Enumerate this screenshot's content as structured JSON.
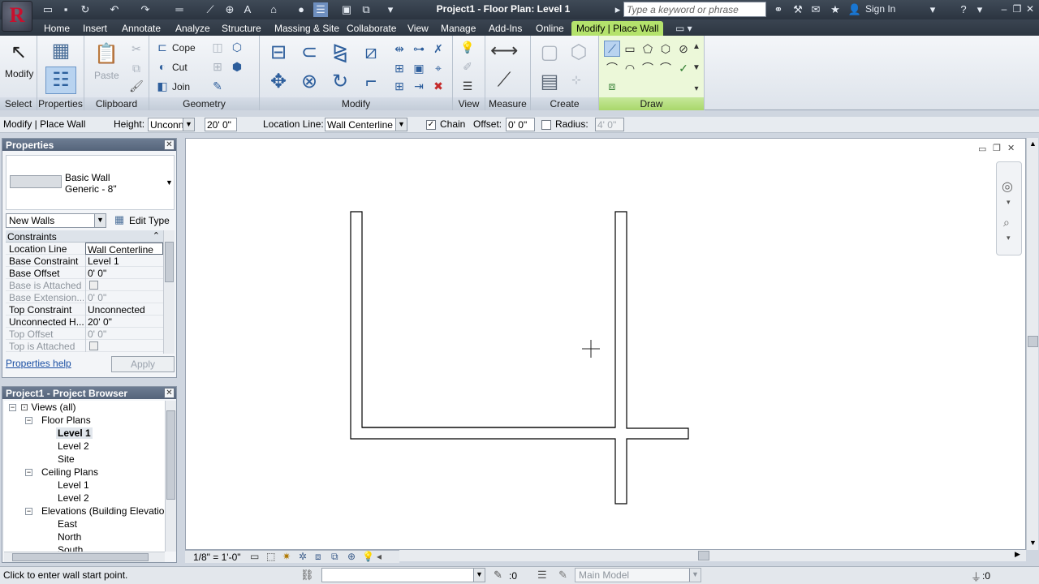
{
  "app": {
    "logo_letter": "R",
    "window_title": "Project1 - Floor Plan: Level 1",
    "search_placeholder": "Type a keyword or phrase",
    "sign_in": "Sign In"
  },
  "ribbon": {
    "tabs": [
      "Home",
      "Insert",
      "Annotate",
      "Analyze",
      "Structure",
      "Massing & Site",
      "Collaborate",
      "View",
      "Manage",
      "Add-Ins",
      "Online",
      "Modify | Place Wall"
    ],
    "active_tab": "Modify | Place Wall",
    "panels": {
      "select": "Select",
      "properties": "Properties",
      "clipboard": "Clipboard",
      "geometry": "Geometry",
      "modify": "Modify",
      "view": "View",
      "measure": "Measure",
      "create": "Create",
      "draw": "Draw"
    },
    "modify_button": "Modify",
    "paste_button": "Paste",
    "cope": "Cope",
    "cut": "Cut",
    "join": "Join"
  },
  "options_bar": {
    "mode": "Modify | Place Wall",
    "height_label": "Height:",
    "height_value": "Unconn",
    "height_dim": "20'  0\"",
    "location_line_label": "Location Line:",
    "location_line_value": "Wall Centerline",
    "chain_label": "Chain",
    "chain_checked": true,
    "offset_label": "Offset:",
    "offset_value": "0'  0\"",
    "radius_label": "Radius:",
    "radius_checked": false,
    "radius_value": "4'  0\""
  },
  "properties": {
    "title": "Properties",
    "type_family": "Basic Wall",
    "type_name": "Generic - 8\"",
    "instance_filter": "New Walls",
    "edit_type": "Edit Type",
    "group": "Constraints",
    "rows": [
      {
        "name": "Location Line",
        "value": "Wall Centerline",
        "dim": false
      },
      {
        "name": "Base Constraint",
        "value": "Level 1",
        "dim": false
      },
      {
        "name": "Base Offset",
        "value": "0'  0\"",
        "dim": false
      },
      {
        "name": "Base is Attached",
        "value": "",
        "dim": true
      },
      {
        "name": "Base Extension...",
        "value": "0'  0\"",
        "dim": true
      },
      {
        "name": "Top Constraint",
        "value": "Unconnected",
        "dim": false
      },
      {
        "name": "Unconnected H...",
        "value": "20'  0\"",
        "dim": false
      },
      {
        "name": "Top Offset",
        "value": "0'  0\"",
        "dim": true
      },
      {
        "name": "Top is Attached",
        "value": "",
        "dim": true
      }
    ],
    "help_link": "Properties help",
    "apply": "Apply"
  },
  "project_browser": {
    "title": "Project1 - Project Browser",
    "items": [
      {
        "label": "Views (all)",
        "level": 0,
        "bold": false
      },
      {
        "label": "Floor Plans",
        "level": 1,
        "bold": false
      },
      {
        "label": "Level 1",
        "level": 2,
        "bold": true
      },
      {
        "label": "Level 2",
        "level": 2,
        "bold": false
      },
      {
        "label": "Site",
        "level": 2,
        "bold": false
      },
      {
        "label": "Ceiling Plans",
        "level": 1,
        "bold": false
      },
      {
        "label": "Level 1",
        "level": 2,
        "bold": false
      },
      {
        "label": "Level 2",
        "level": 2,
        "bold": false
      },
      {
        "label": "Elevations (Building Elevation)",
        "level": 1,
        "bold": false
      },
      {
        "label": "East",
        "level": 2,
        "bold": false
      },
      {
        "label": "North",
        "level": 2,
        "bold": false
      },
      {
        "label": "South",
        "level": 2,
        "bold": false
      }
    ]
  },
  "view_control": {
    "scale": "1/8\" = 1'-0\""
  },
  "status": {
    "message": "Click to enter wall start point.",
    "selection_count": ":0",
    "workset": "Main Model",
    "filter_count": ":0"
  }
}
